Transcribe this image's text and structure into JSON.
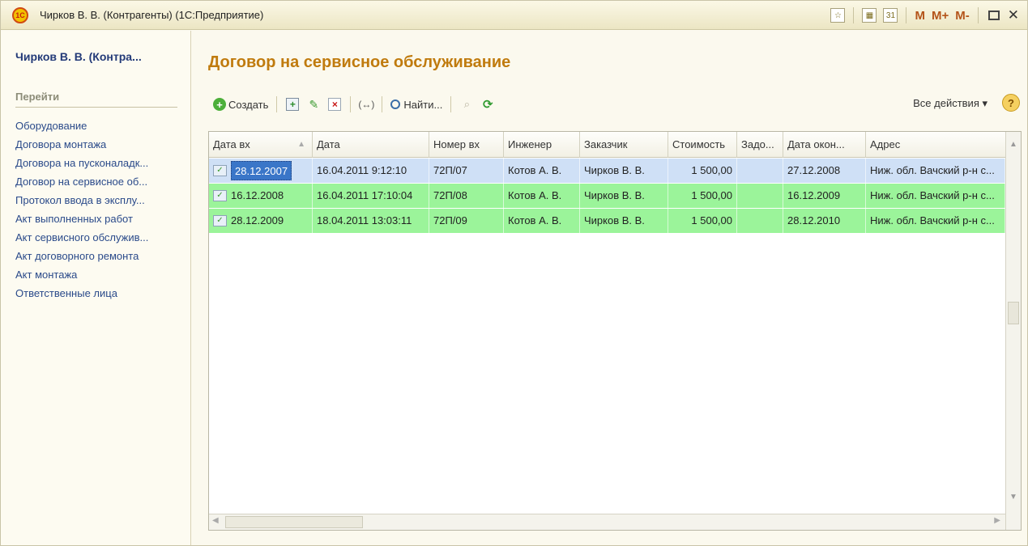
{
  "window": {
    "logo_text": "1С",
    "title": "Чирков В. В. (Контрагенты) (1С:Предприятие)",
    "toolbar": {
      "m": "M",
      "m_plus": "M+",
      "m_minus": "M-",
      "close": "✕"
    }
  },
  "sidebar": {
    "title": "Чирков В. В. (Контра...",
    "section": "Перейти",
    "items": [
      {
        "label": "Оборудование"
      },
      {
        "label": "Договора монтажа"
      },
      {
        "label": "Договора на пусконаладк..."
      },
      {
        "label": "Договор на сервисное об..."
      },
      {
        "label": "Протокол ввода в эксплу..."
      },
      {
        "label": "Акт выполненных работ"
      },
      {
        "label": "Акт сервисного обслужив..."
      },
      {
        "label": "Акт договорного ремонта"
      },
      {
        "label": "Акт монтажа"
      },
      {
        "label": "Ответственные лица"
      }
    ]
  },
  "main": {
    "title": "Договор на сервисное обслуживание",
    "toolbar": {
      "create_label": "Создать",
      "find_label": "Найти...",
      "all_actions_label": "Все действия ▾",
      "help_label": "?"
    },
    "table": {
      "columns": [
        {
          "label": "Дата вх"
        },
        {
          "label": "Дата"
        },
        {
          "label": "Номер вх"
        },
        {
          "label": "Инженер"
        },
        {
          "label": "Заказчик"
        },
        {
          "label": "Стоимость"
        },
        {
          "label": "Задо..."
        },
        {
          "label": "Дата окон..."
        },
        {
          "label": "Адрес"
        }
      ],
      "rows": [
        {
          "date_in": "28.12.2007",
          "date": "16.04.2011 9:12:10",
          "number_in": "72П/07",
          "engineer": "Котов А. В.",
          "customer": "Чирков В. В.",
          "cost": "1 500,00",
          "debt": "",
          "end_date": "27.12.2008",
          "address": "Ниж. обл. Вачский р-н с...",
          "selected": true
        },
        {
          "date_in": "16.12.2008",
          "date": "16.04.2011 17:10:04",
          "number_in": "72П/08",
          "engineer": "Котов А. В.",
          "customer": "Чирков В. В.",
          "cost": "1 500,00",
          "debt": "",
          "end_date": "16.12.2009",
          "address": "Ниж. обл. Вачский р-н с...",
          "selected": false
        },
        {
          "date_in": "28.12.2009",
          "date": "18.04.2011 13:03:11",
          "number_in": "72П/09",
          "engineer": "Котов А. В.",
          "customer": "Чирков В. В.",
          "cost": "1 500,00",
          "debt": "",
          "end_date": "28.12.2010",
          "address": "Ниж. обл. Вачский р-н с...",
          "selected": false
        }
      ]
    }
  },
  "colors": {
    "title_accent": "#c07b0e",
    "link": "#2a4a8a",
    "row_green": "#9bf49a",
    "row_selected": "#cfe0f6",
    "cell_selected": "#3a76c8"
  }
}
